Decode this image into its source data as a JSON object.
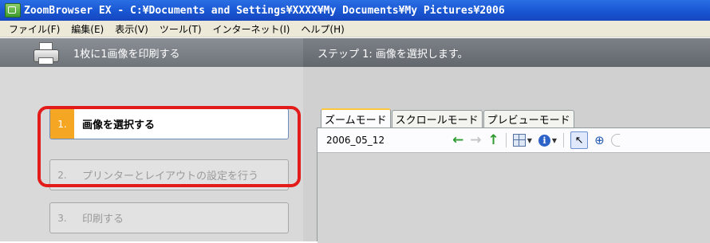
{
  "window": {
    "title": "ZoomBrowser EX  -  C:¥Documents and Settings¥XXXX¥My Documents¥My Pictures¥2006"
  },
  "menu": [
    {
      "label": "ファイル(F)"
    },
    {
      "label": "編集(E)"
    },
    {
      "label": "表示(V)"
    },
    {
      "label": "ツール(T)"
    },
    {
      "label": "インターネット(I)"
    },
    {
      "label": "ヘルプ(H)"
    }
  ],
  "left_panel": {
    "header": "1枚に1画像を印刷する",
    "icon": "printer-icon",
    "steps": [
      {
        "num": "1.",
        "label": "画像を選択する",
        "active": true
      },
      {
        "num": "2.",
        "label": "プリンターとレイアウトの設定を行う",
        "active": false
      },
      {
        "num": "3.",
        "label": "印刷する",
        "active": false
      }
    ]
  },
  "right_panel": {
    "header": "ステップ 1: 画像を選択します。",
    "tabs": [
      {
        "label": "ズームモード",
        "active": true
      },
      {
        "label": "スクロールモード",
        "active": false
      },
      {
        "label": "プレビューモード",
        "active": false
      }
    ],
    "folder": "2006_05_12",
    "toolbar": {
      "back_icon": "←",
      "forward_icon": "→",
      "up_icon": "↑",
      "info_glyph": "i",
      "cursor_glyph": "↖",
      "zoom_glyph": "⊕"
    }
  },
  "colors": {
    "highlight": "#e31b1b",
    "active_step_number": "#f5a623",
    "title_bar": "#1a58d3"
  }
}
